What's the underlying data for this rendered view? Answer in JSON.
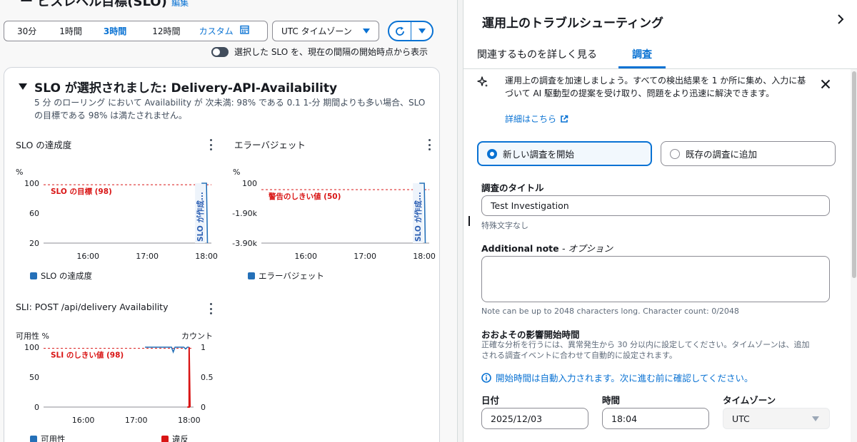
{
  "left": {
    "top_clipped_title": "ー ビスレベル目標(SLO)",
    "top_clipped_link": "編集",
    "time_range": {
      "options": [
        "30分",
        "1時間",
        "3時間",
        "12時間",
        "カスタム"
      ],
      "selected": "3時間"
    },
    "timezone": {
      "value": "UTC タイムゾーン"
    },
    "toggle_label": "選択した SLO を、現在の間隔の開始時点から表示",
    "slo": {
      "title": "SLO が選択されました: Delivery-API-Availability",
      "description": "5 分 のローリング において Availability が 次未満: 98% である 0.1 1-分 期間よりも多い場合、SLO の目標である 98% は満たされません。"
    },
    "charts": {
      "attainment": {
        "title": "SLO の達成度",
        "unit": "%",
        "legend": "SLO の達成度"
      },
      "budget": {
        "title": "エラーバジェット",
        "unit": "%",
        "legend": "エラーバジェット"
      },
      "sli": {
        "title": "SLI: POST /api/delivery Availability",
        "unit_left": "可用性 %",
        "unit_right": "カウント",
        "legend_a": "可用性",
        "legend_b": "違反"
      }
    }
  },
  "chart_data": [
    {
      "type": "line",
      "title": "SLO の達成度",
      "ylabel": "%",
      "ylim": [
        20,
        100
      ],
      "y_ticks": [
        "100",
        "60",
        "20"
      ],
      "x_ticks": [
        "16:00",
        "17:00",
        "18:00"
      ],
      "threshold": {
        "label": "SLO の目標 (98)",
        "value": 98
      },
      "annotation": "SLO が作成...",
      "series": [
        {
          "name": "SLO の達成度",
          "color": "#2470b8",
          "points": [
            [
              "17:55",
              100
            ],
            [
              "18:00",
              100
            ],
            [
              "18:01",
              20
            ]
          ]
        }
      ]
    },
    {
      "type": "line",
      "title": "エラーバジェット",
      "ylabel": "%",
      "ylim": [
        -3.9,
        100
      ],
      "y_ticks": [
        "100",
        "-1.90k",
        "-3.90k"
      ],
      "x_ticks": [
        "16:00",
        "17:00",
        "18:00"
      ],
      "threshold": {
        "label": "警告のしきい値 (50)",
        "value": 50
      },
      "annotation": "SLO が作成...",
      "series": [
        {
          "name": "エラーバジェット",
          "color": "#2470b8",
          "points": [
            [
              "17:55",
              100
            ],
            [
              "18:00",
              100
            ],
            [
              "18:01",
              -3.9
            ]
          ]
        }
      ]
    },
    {
      "type": "line",
      "title": "SLI: POST /api/delivery Availability",
      "ylabel": "可用性 %",
      "y2label": "カウント",
      "ylim": [
        0,
        100
      ],
      "y2lim": [
        0,
        1
      ],
      "y_ticks": [
        "100",
        "50",
        "0"
      ],
      "y2_ticks": [
        "1",
        "0.5",
        "0"
      ],
      "x_ticks": [
        "16:00",
        "17:00",
        "18:00"
      ],
      "threshold": {
        "label": "SLI のしきい値 (98)",
        "value": 98
      },
      "series": [
        {
          "name": "可用性",
          "color": "#2470b8",
          "points": [
            [
              "17:10",
              100
            ],
            [
              "17:40",
              100
            ],
            [
              "17:42",
              92
            ],
            [
              "17:44",
              100
            ],
            [
              "17:54",
              100
            ],
            [
              "17:56",
              97
            ],
            [
              "17:58",
              100
            ],
            [
              "18:00",
              100
            ]
          ]
        },
        {
          "name": "違反",
          "color": "#d91515",
          "points": [
            [
              "17:58",
              0
            ],
            [
              "18:00",
              0
            ],
            [
              "18:00",
              1
            ],
            [
              "18:01",
              0
            ]
          ]
        }
      ]
    }
  ],
  "right": {
    "panel_title": "運用上のトラブルシューティング",
    "tabs": [
      {
        "label": "関連するものを詳しく見る",
        "active": false
      },
      {
        "label": "調査",
        "active": true
      }
    ],
    "info": {
      "text": "運用上の調査を加速しましょう。すべての検出結果を 1 か所に集め、入力に基づいて AI 駆動型の提案を受け取り、問題をより迅速に解決できます。",
      "link": "詳細はこちら"
    },
    "radios": {
      "new": "新しい調査を開始",
      "existing": "既存の調査に追加"
    },
    "title_field": {
      "label": "調査のタイトル",
      "value": "Test Investigation",
      "hint": "特殊文字なし"
    },
    "note_field": {
      "label": "Additional note",
      "optional": "- オプション",
      "value": "",
      "hint": "Note can be up to 2048 characters long. Character count: 0/2048"
    },
    "impact": {
      "label": "おおよその影響開始時間",
      "desc": "正確な分析を行うには、異常発生から 30 分以内に設定してください。タイムゾーンは、追加される調査イベントに合わせて自動的に設定されます。",
      "auto_info": "開始時間は自動入力されます。次に進む前に確認してください。",
      "date_label": "日付",
      "date_value": "2025/12/03",
      "time_label": "時間",
      "time_value": "18:04",
      "tz_label": "タイムゾーン",
      "tz_value": "UTC"
    }
  }
}
